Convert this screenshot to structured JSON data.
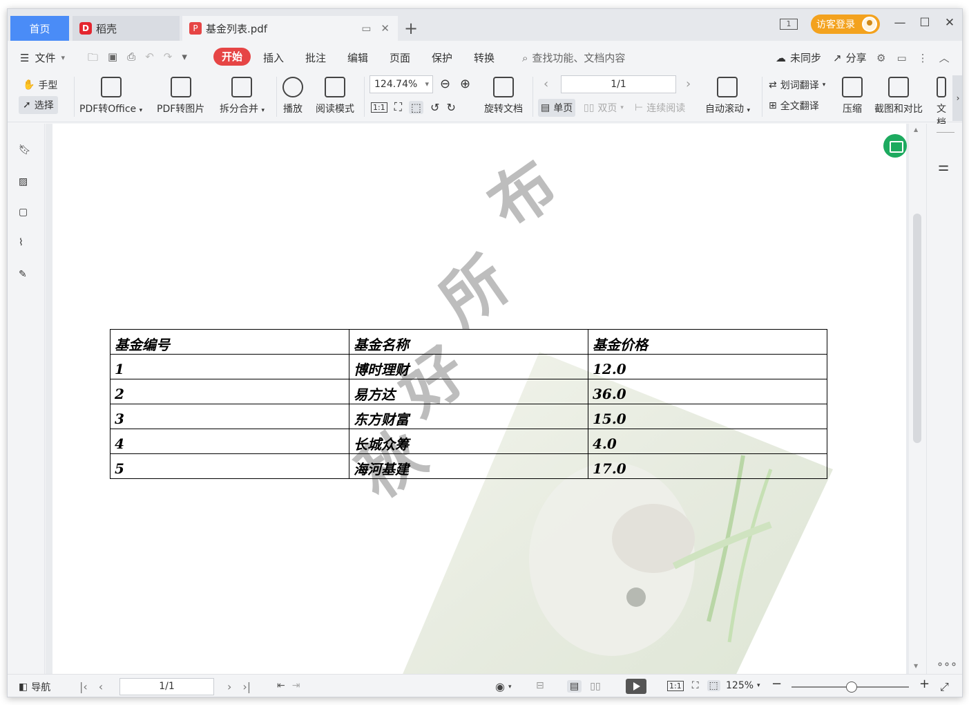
{
  "tabs": {
    "home": "首页",
    "docer": "稻壳",
    "pdf": "基金列表.pdf"
  },
  "titlebar": {
    "login": "访客登录",
    "page_indicator": "1"
  },
  "menu": {
    "file": "文件",
    "items": [
      "开始",
      "插入",
      "批注",
      "编辑",
      "页面",
      "保护",
      "转换"
    ],
    "search_placeholder": "查找功能、文档内容",
    "sync": "未同步",
    "share": "分享"
  },
  "ribbon": {
    "hand": "手型",
    "select": "选择",
    "pdf_to_office": "PDF转Office",
    "pdf_to_image": "PDF转图片",
    "split_merge": "拆分合并",
    "play": "播放",
    "read_mode": "阅读模式",
    "zoom": "124.74%",
    "rotate_doc": "旋转文档",
    "page_value": "1/1",
    "single_page": "单页",
    "double_page": "双页",
    "continuous": "连续阅读",
    "auto_scroll": "自动滚动",
    "word_translate": "划词翻译",
    "full_translate": "全文翻译",
    "compress": "压缩",
    "screenshot_compare": "截图和对比",
    "more": "文档"
  },
  "document": {
    "watermark_chars": [
      "布",
      "所",
      "好",
      "秋"
    ],
    "table": {
      "headers": [
        "基金编号",
        "基金名称",
        "基金价格"
      ],
      "rows": [
        [
          "1",
          "博时理财",
          "12.0"
        ],
        [
          "2",
          "易方达",
          "36.0"
        ],
        [
          "3",
          "东方财富",
          "15.0"
        ],
        [
          "4",
          "长城众筹",
          "4.0"
        ],
        [
          "5",
          "海河基建",
          "17.0"
        ]
      ]
    }
  },
  "statusbar": {
    "nav": "导航",
    "page": "1/1",
    "zoom": "125%"
  },
  "colors": {
    "accent_red": "#e64545",
    "home_tab": "#4a8cf7",
    "login": "#f3a21e",
    "green_fab": "#1daa5f"
  }
}
